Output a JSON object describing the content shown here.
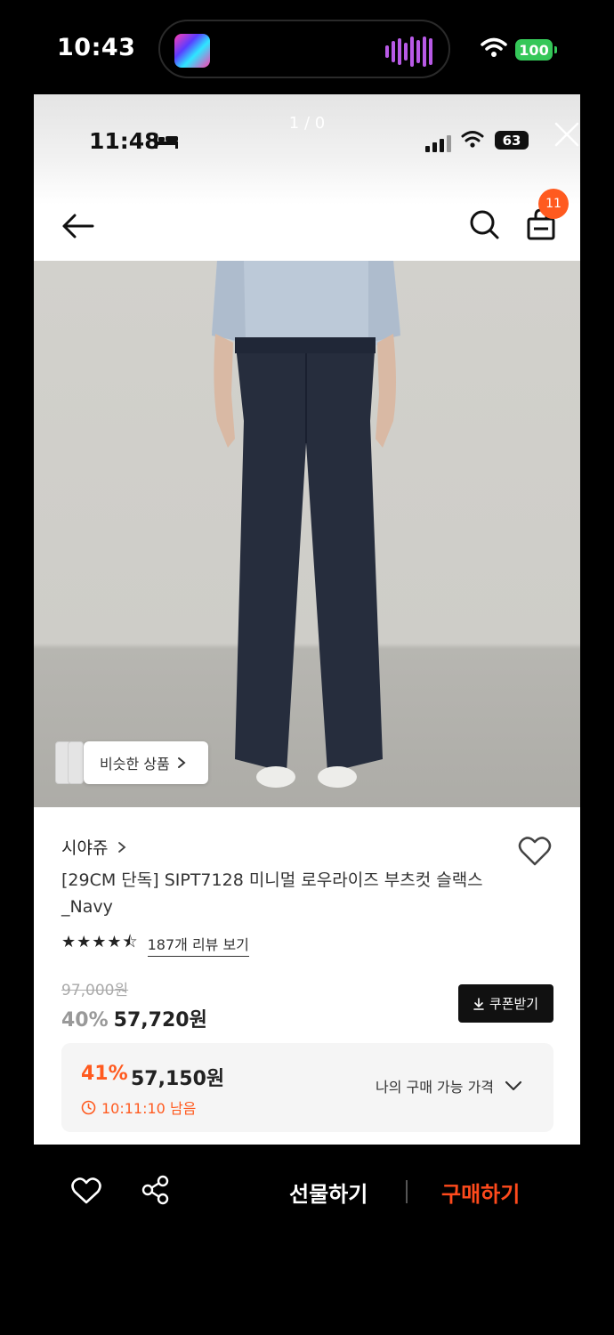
{
  "outer_status": {
    "time": "10:43",
    "battery": "100"
  },
  "inner_status": {
    "time": "11:48",
    "pager": "1 / 0",
    "battery": "63"
  },
  "header": {
    "cart_count": "11"
  },
  "photo": {
    "similar_label": "비슷한 상품"
  },
  "product": {
    "brand": "시야쥬",
    "title": "[29CM 단독] SIPT7128 미니멀 로우라이즈 부츠컷 슬랙스 _Navy",
    "rating": 4.5,
    "stars": "★★★★⯪",
    "review_link": "187개 리뷰 보기",
    "original_price": "97,000원",
    "discount_rate": "40%",
    "price": "57,720원",
    "coupon_label": "쿠폰받기"
  },
  "best_price": {
    "rate": "41%",
    "price": "57,150원",
    "timer": "10:11:10 남음",
    "label": "나의 구매 가능 가격"
  },
  "bottom": {
    "gift_label": "선물하기",
    "buy_label": "구매하기"
  },
  "colors": {
    "accent": "#ff5a1f",
    "buy": "#ff4a1c",
    "dark": "#111111",
    "battery_green": "#35c759"
  },
  "icons": [
    "back-arrow-icon",
    "search-icon",
    "shopping-bag-icon",
    "heart-icon",
    "share-icon",
    "download-icon",
    "clock-icon",
    "chevron-down-icon",
    "chevron-right-icon",
    "close-icon"
  ]
}
